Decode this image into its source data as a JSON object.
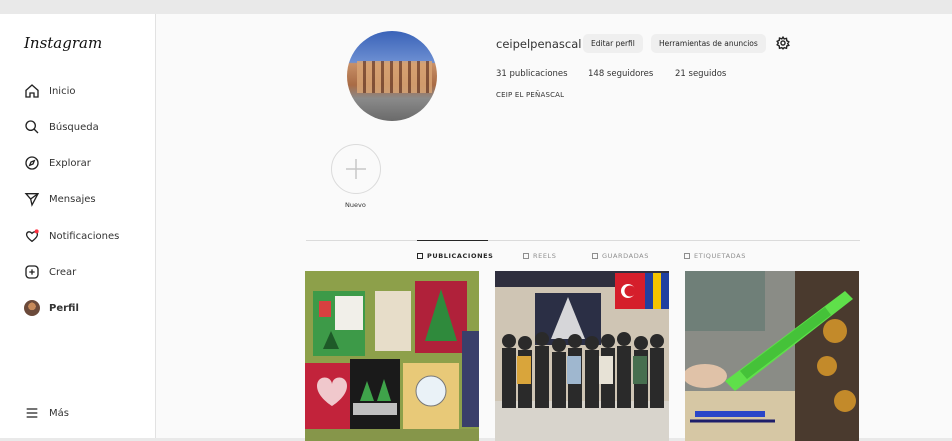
{
  "sidebar": {
    "logo": "Instagram",
    "items": [
      {
        "label": "Inicio",
        "icon": "home-icon"
      },
      {
        "label": "Búsqueda",
        "icon": "search-icon"
      },
      {
        "label": "Explorar",
        "icon": "compass-icon"
      },
      {
        "label": "Mensajes",
        "icon": "send-icon"
      },
      {
        "label": "Notificaciones",
        "icon": "heart-icon"
      },
      {
        "label": "Crear",
        "icon": "plus-square-icon"
      },
      {
        "label": "Perfil",
        "icon": "avatar"
      }
    ],
    "more": "Más"
  },
  "profile": {
    "username": "ceipelpenascal",
    "edit_button": "Editar perfil",
    "ads_button": "Herramientas de anuncios",
    "posts": "31 publicaciones",
    "followers": "148 seguidores",
    "following": "21 seguidos",
    "bio": "CEIP EL PEÑASCAL"
  },
  "highlights": {
    "new_label": "Nuevo"
  },
  "tabs": [
    {
      "label": "PUBLICACIONES",
      "icon": "grid-icon"
    },
    {
      "label": "REELS",
      "icon": "reels-icon"
    },
    {
      "label": "GUARDADAS",
      "icon": "bookmark-icon"
    },
    {
      "label": "ETIQUETADAS",
      "icon": "tagged-icon"
    }
  ],
  "colors": {
    "accent_notification": "#ff3040",
    "text": "#262626",
    "muted": "#8e8e8e"
  }
}
